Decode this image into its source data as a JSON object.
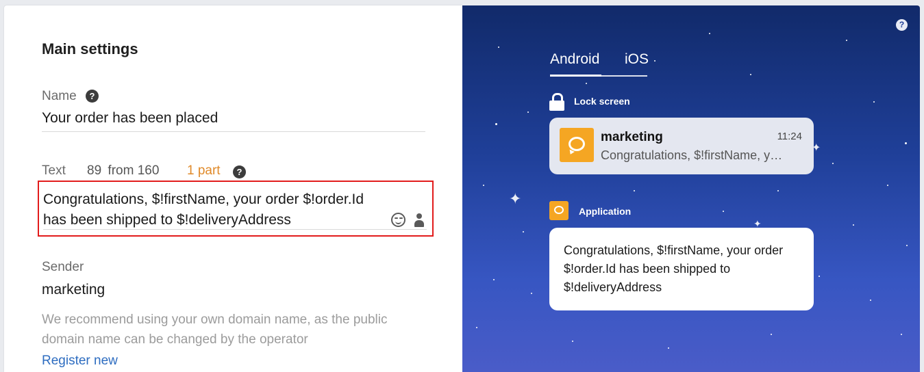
{
  "main": {
    "title": "Main settings",
    "name_label": "Name",
    "name_value": "Your order has been placed",
    "text_label": "Text",
    "char_count": "89",
    "char_from": "from 160",
    "parts": "1 part",
    "text_value": "Congratulations, $!firstName, your order $!order.Id has been shipped to $!deliveryAddress",
    "sender_label": "Sender",
    "sender_value": "marketing",
    "hint": "We recommend using your own domain name, as the public domain name can be changed by the operator",
    "register_link": "Register new"
  },
  "preview": {
    "tabs": [
      "Android",
      "iOS"
    ],
    "lock_screen_label": "Lock screen",
    "notification": {
      "app": "marketing",
      "time": "11:24",
      "text": "Congratulations, $!firstName, y…"
    },
    "application_label": "Application",
    "app_message": "Congratulations, $!firstName, your order $!order.Id has been shipped to $!deliveryAddress"
  },
  "colors": {
    "accent_orange": "#f5a623",
    "highlight_red": "#e21b1b",
    "link_blue": "#2d6cc0",
    "parts_orange": "#e08a2a",
    "preview_bg": "#1f3f98"
  },
  "icons": [
    "help-icon",
    "emoji-icon",
    "person-icon",
    "lock-icon",
    "chat-bubble-icon"
  ]
}
